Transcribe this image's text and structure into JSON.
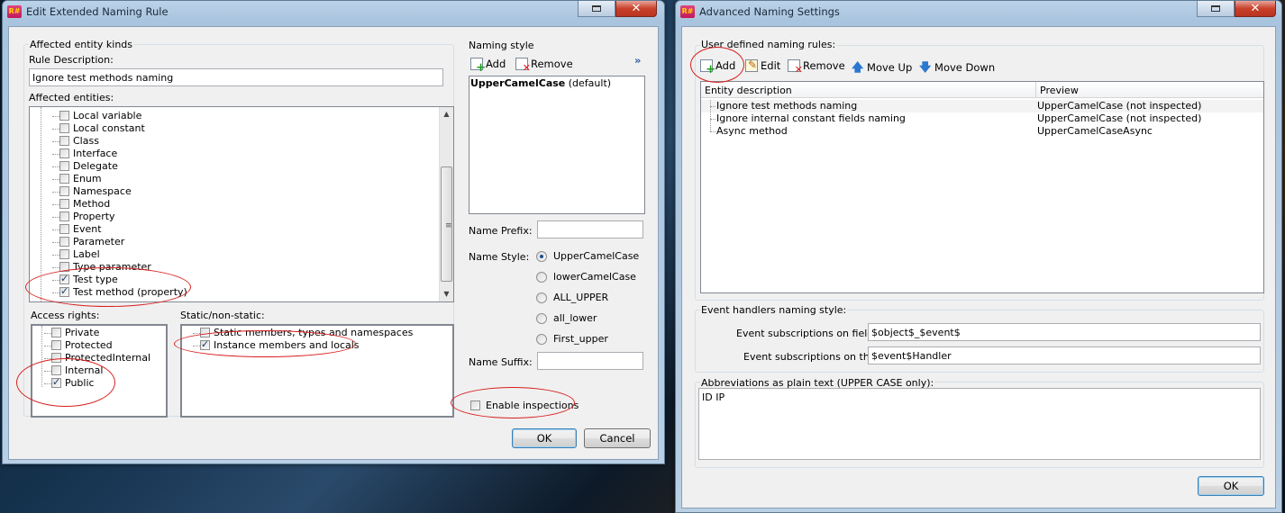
{
  "left": {
    "title": "Edit Extended Naming Rule",
    "affected_kinds_group": "Affected entity kinds",
    "rule_description_label": "Rule Description:",
    "rule_description_value": "Ignore test methods naming",
    "affected_entities_label": "Affected entities:",
    "entities": [
      {
        "label": "Local variable",
        "checked": false
      },
      {
        "label": "Local constant",
        "checked": false
      },
      {
        "label": "Class",
        "checked": false
      },
      {
        "label": "Interface",
        "checked": false
      },
      {
        "label": "Delegate",
        "checked": false
      },
      {
        "label": "Enum",
        "checked": false
      },
      {
        "label": "Namespace",
        "checked": false
      },
      {
        "label": "Method",
        "checked": false
      },
      {
        "label": "Property",
        "checked": false
      },
      {
        "label": "Event",
        "checked": false
      },
      {
        "label": "Parameter",
        "checked": false
      },
      {
        "label": "Label",
        "checked": false
      },
      {
        "label": "Type parameter",
        "checked": false
      },
      {
        "label": "Test type",
        "checked": true
      },
      {
        "label": "Test method (property)",
        "checked": true
      }
    ],
    "access_rights_label": "Access rights:",
    "access_rights": [
      {
        "label": "Private",
        "checked": false
      },
      {
        "label": "Protected",
        "checked": false
      },
      {
        "label": "ProtectedInternal",
        "checked": false
      },
      {
        "label": "Internal",
        "checked": false
      },
      {
        "label": "Public",
        "checked": true
      }
    ],
    "static_label": "Static/non-static:",
    "static_items": [
      {
        "label": "Static members, types and namespaces",
        "checked": false
      },
      {
        "label": "Instance members and locals",
        "checked": true
      }
    ],
    "naming_style_group": "Naming style",
    "add_label": "Add",
    "remove_label": "Remove",
    "more_glyph": "»",
    "styles": [
      {
        "name": "UpperCamelCase",
        "suffix": " (default)"
      }
    ],
    "name_prefix_label": "Name Prefix:",
    "name_style_label": "Name Style:",
    "name_style_options": [
      {
        "label": "UpperCamelCase",
        "selected": true
      },
      {
        "label": "lowerCamelCase",
        "selected": false
      },
      {
        "label": "ALL_UPPER",
        "selected": false
      },
      {
        "label": "all_lower",
        "selected": false
      },
      {
        "label": "First_upper",
        "selected": false
      }
    ],
    "name_suffix_label": "Name Suffix:",
    "enable_inspections_label": "Enable inspections",
    "enable_inspections_checked": false,
    "ok_label": "OK",
    "cancel_label": "Cancel"
  },
  "right": {
    "title": "Advanced Naming Settings",
    "user_rules_group": "User defined naming rules:",
    "toolbar": {
      "add": "Add",
      "edit": "Edit",
      "remove": "Remove",
      "move_up": "Move Up",
      "move_down": "Move Down"
    },
    "columns": [
      "Entity description",
      "Preview"
    ],
    "rules": [
      {
        "description": "Ignore test methods naming",
        "preview": "UpperCamelCase (not inspected)"
      },
      {
        "description": "Ignore internal constant fields naming",
        "preview": "UpperCamelCase (not inspected)"
      },
      {
        "description": "Async method",
        "preview": "UpperCamelCaseAsync"
      }
    ],
    "event_group": "Event handlers naming style:",
    "event_fields_label": "Event subscriptions on fields:",
    "event_fields_value": "$object$_$event$",
    "event_this_label": "Event subscriptions on this:",
    "event_this_value": "$event$Handler",
    "abbrev_group": "Abbreviations as plain text (UPPER CASE only):",
    "abbrev_value": "ID IP",
    "ok_label": "OK"
  },
  "colors": {
    "annotation": "#d81e1e",
    "titlebar": "#b8cfe4",
    "dialog_bg": "#f0f0f0"
  }
}
